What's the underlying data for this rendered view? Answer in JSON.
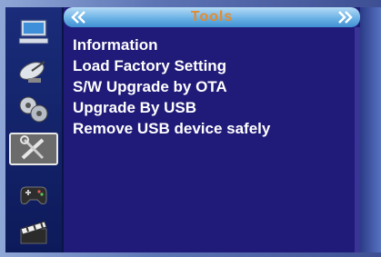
{
  "header": {
    "title": "Tools",
    "left_arrow_icon": "double-chevron-left-icon",
    "right_arrow_icon": "double-chevron-right-icon"
  },
  "sidebar": {
    "items": [
      {
        "icon": "computer-icon",
        "selected": false
      },
      {
        "icon": "satellite-dish-icon",
        "selected": false
      },
      {
        "icon": "film-reels-icon",
        "selected": false
      },
      {
        "icon": "tools-icon",
        "selected": true
      },
      {
        "icon": "gamepad-icon",
        "selected": false
      },
      {
        "icon": "clapperboard-icon",
        "selected": false
      }
    ]
  },
  "menu": {
    "items": [
      {
        "label": "Information"
      },
      {
        "label": "Load Factory Setting"
      },
      {
        "label": "S/W Upgrade by OTA"
      },
      {
        "label": "Upgrade By USB"
      },
      {
        "label": "Remove USB device safely"
      }
    ]
  },
  "colors": {
    "panel": "#201a78",
    "title_text": "#e58a2b",
    "menu_text": "#ffffff"
  }
}
